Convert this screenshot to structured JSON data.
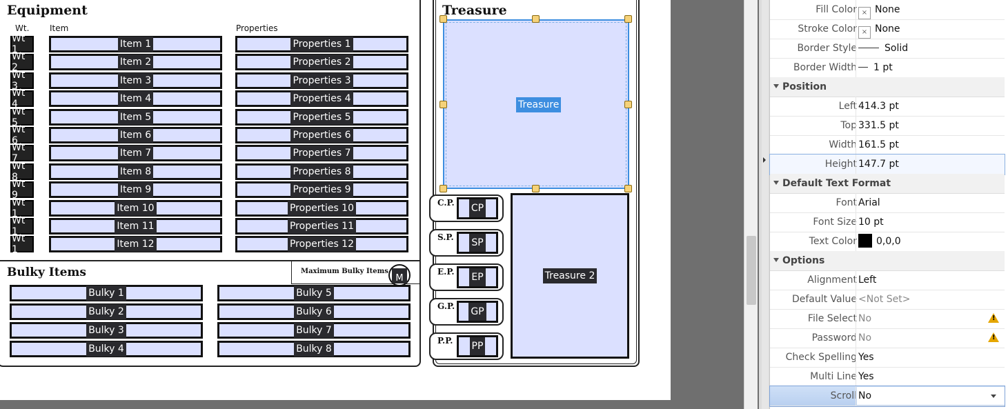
{
  "equipment": {
    "title": "Equipment",
    "headers": {
      "wt": "Wt.",
      "item": "Item",
      "properties": "Properties"
    },
    "rows": [
      {
        "wt": "Wt 1",
        "item": "Item 1",
        "prop": "Properties 1"
      },
      {
        "wt": "Wt 2",
        "item": "Item 2",
        "prop": "Properties 2"
      },
      {
        "wt": "Wt 3",
        "item": "Item 3",
        "prop": "Properties 3"
      },
      {
        "wt": "Wt 4",
        "item": "Item 4",
        "prop": "Properties 4"
      },
      {
        "wt": "Wt 5",
        "item": "Item 5",
        "prop": "Properties 5"
      },
      {
        "wt": "Wt 6",
        "item": "Item 6",
        "prop": "Properties 6"
      },
      {
        "wt": "Wt 7",
        "item": "Item 7",
        "prop": "Properties 7"
      },
      {
        "wt": "Wt 8",
        "item": "Item 8",
        "prop": "Properties 8"
      },
      {
        "wt": "Wt 9",
        "item": "Item 9",
        "prop": "Properties 9"
      },
      {
        "wt": "Wt 1",
        "item": "Item 10",
        "prop": "Properties 10"
      },
      {
        "wt": "Wt 1",
        "item": "Item 11",
        "prop": "Properties 11"
      },
      {
        "wt": "Wt 1",
        "item": "Item 12",
        "prop": "Properties 12"
      }
    ]
  },
  "bulky": {
    "title": "Bulky Items",
    "max_label": "Maximum Bulky Items",
    "max_field": "M",
    "left": [
      "Bulky 1",
      "Bulky 2",
      "Bulky 3",
      "Bulky 4"
    ],
    "right": [
      "Bulky 5",
      "Bulky 6",
      "Bulky 7",
      "Bulky 8"
    ]
  },
  "treasure": {
    "title": "Treasure",
    "field1": "Treasure",
    "field2": "Treasure 2",
    "coins": [
      {
        "label": "C.P.",
        "field": "CP"
      },
      {
        "label": "S.P.",
        "field": "SP"
      },
      {
        "label": "E.P.",
        "field": "EP"
      },
      {
        "label": "G.P.",
        "field": "GP"
      },
      {
        "label": "P.P.",
        "field": "PP"
      }
    ]
  },
  "properties_panel": {
    "rows_top": [
      {
        "key": "Fill Color",
        "value": "None"
      },
      {
        "key": "Stroke Color",
        "value": "None"
      },
      {
        "key": "Border Style",
        "value": "Solid"
      },
      {
        "key": "Border Width",
        "value": "1 pt"
      }
    ],
    "section_position": "Position",
    "position": [
      {
        "key": "Left",
        "value": "414.3 pt"
      },
      {
        "key": "Top",
        "value": "331.5 pt"
      },
      {
        "key": "Width",
        "value": "161.5 pt"
      },
      {
        "key": "Height",
        "value": "147.7 pt"
      }
    ],
    "section_text": "Default Text Format",
    "text": [
      {
        "key": "Font",
        "value": "Arial"
      },
      {
        "key": "Font Size",
        "value": "10 pt"
      },
      {
        "key": "Text Color",
        "value": "0,0,0"
      }
    ],
    "section_options": "Options",
    "options": [
      {
        "key": "Alignment",
        "value": "Left"
      },
      {
        "key": "Default Value",
        "value": "<Not Set>"
      },
      {
        "key": "File Select",
        "value": "No"
      },
      {
        "key": "Password",
        "value": "No"
      },
      {
        "key": "Check Spelling",
        "value": "Yes"
      },
      {
        "key": "Multi Line",
        "value": "Yes"
      },
      {
        "key": "Scroll",
        "value": "No"
      }
    ]
  },
  "colors": {
    "field_bg": "#dbe0ff",
    "selection": "#3d8ee0",
    "handle": "#f5d27a",
    "text_color_swatch": "#000000"
  }
}
